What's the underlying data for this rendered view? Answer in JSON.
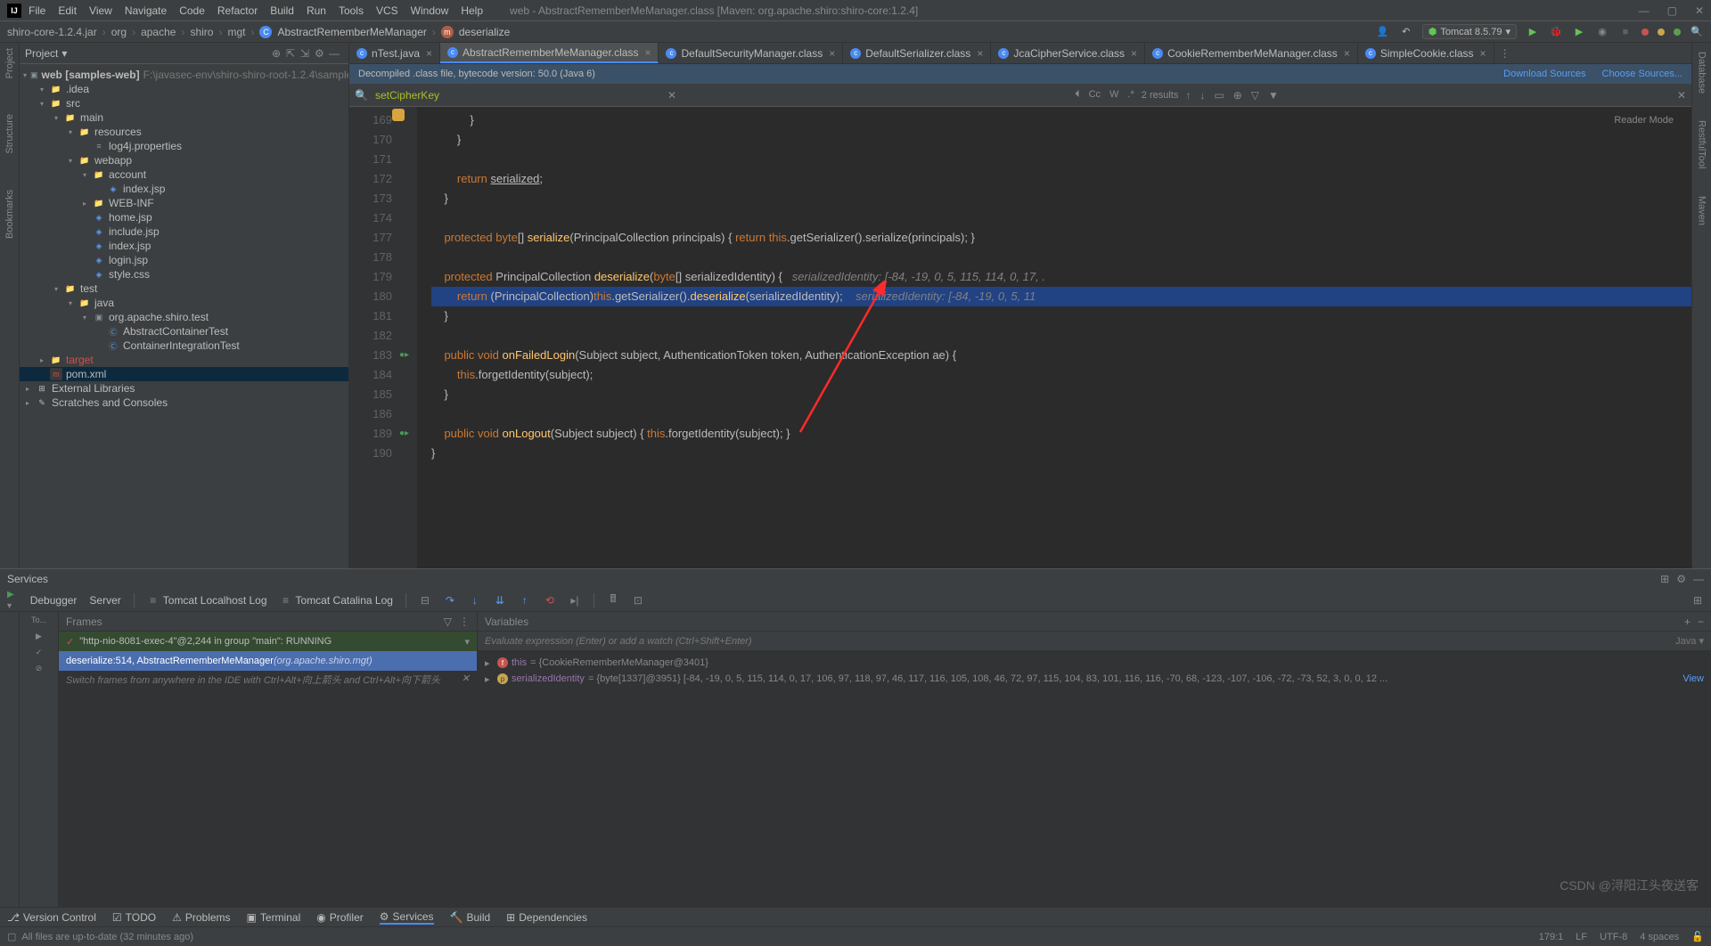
{
  "titlebar": {
    "menus": [
      "File",
      "Edit",
      "View",
      "Navigate",
      "Code",
      "Refactor",
      "Build",
      "Run",
      "Tools",
      "VCS",
      "Window",
      "Help"
    ],
    "title": "web - AbstractRememberMeManager.class [Maven: org.apache.shiro:shiro-core:1.2.4]"
  },
  "breadcrumb": {
    "jar": "shiro-core-1.2.4.jar",
    "parts": [
      "org",
      "apache",
      "shiro",
      "mgt"
    ],
    "class": "AbstractRememberMeManager",
    "method": "deserialize"
  },
  "runconfig": "Tomcat 8.5.79",
  "project": {
    "header": "Project",
    "root": "web [samples-web]",
    "root_path": "F:\\javasec-env\\shiro-shiro-root-1.2.4\\samples\\web",
    "items": [
      {
        "depth": 1,
        "arrow": "▾",
        "icon": "folder",
        "name": ".idea"
      },
      {
        "depth": 1,
        "arrow": "▾",
        "icon": "folder",
        "name": "src"
      },
      {
        "depth": 2,
        "arrow": "▾",
        "icon": "folder",
        "name": "main"
      },
      {
        "depth": 3,
        "arrow": "▾",
        "icon": "folder",
        "name": "resources"
      },
      {
        "depth": 4,
        "arrow": "",
        "icon": "prop",
        "name": "log4j.properties"
      },
      {
        "depth": 3,
        "arrow": "▾",
        "icon": "folder",
        "name": "webapp"
      },
      {
        "depth": 4,
        "arrow": "▾",
        "icon": "folder",
        "name": "account"
      },
      {
        "depth": 5,
        "arrow": "",
        "icon": "jsp",
        "name": "index.jsp"
      },
      {
        "depth": 4,
        "arrow": "▸",
        "icon": "folder",
        "name": "WEB-INF"
      },
      {
        "depth": 4,
        "arrow": "",
        "icon": "jsp",
        "name": "home.jsp"
      },
      {
        "depth": 4,
        "arrow": "",
        "icon": "jsp",
        "name": "include.jsp"
      },
      {
        "depth": 4,
        "arrow": "",
        "icon": "jsp",
        "name": "index.jsp"
      },
      {
        "depth": 4,
        "arrow": "",
        "icon": "jsp",
        "name": "login.jsp"
      },
      {
        "depth": 4,
        "arrow": "",
        "icon": "css",
        "name": "style.css"
      },
      {
        "depth": 2,
        "arrow": "▾",
        "icon": "folder",
        "name": "test"
      },
      {
        "depth": 3,
        "arrow": "▾",
        "icon": "folder",
        "name": "java"
      },
      {
        "depth": 4,
        "arrow": "▾",
        "icon": "pkg",
        "name": "org.apache.shiro.test"
      },
      {
        "depth": 5,
        "arrow": "",
        "icon": "java",
        "name": "AbstractContainerTest"
      },
      {
        "depth": 5,
        "arrow": "",
        "icon": "java",
        "name": "ContainerIntegrationTest"
      },
      {
        "depth": 1,
        "arrow": "▸",
        "icon": "folder",
        "name": "target",
        "cls": "exclude"
      },
      {
        "depth": 1,
        "arrow": "",
        "icon": "xml",
        "name": "pom.xml",
        "sel": true
      },
      {
        "depth": 0,
        "arrow": "▸",
        "icon": "lib",
        "name": "External Libraries"
      },
      {
        "depth": 0,
        "arrow": "▸",
        "icon": "scratch",
        "name": "Scratches and Consoles"
      }
    ]
  },
  "tabs": [
    {
      "label": "nTest.java",
      "active": false
    },
    {
      "label": "AbstractRememberMeManager.class",
      "active": true
    },
    {
      "label": "DefaultSecurityManager.class",
      "active": false
    },
    {
      "label": "DefaultSerializer.class",
      "active": false
    },
    {
      "label": "JcaCipherService.class",
      "active": false
    },
    {
      "label": "CookieRememberMeManager.class",
      "active": false
    },
    {
      "label": "SimpleCookie.class",
      "active": false
    }
  ],
  "infobar": {
    "text": "Decompiled .class file, bytecode version: 50.0 (Java 6)",
    "link1": "Download Sources",
    "link2": "Choose Sources..."
  },
  "search": {
    "query": "setCipherKey",
    "results": "2 results"
  },
  "reader_mode": "Reader Mode",
  "code": {
    "lines": [
      {
        "n": "",
        "html": "            }"
      },
      {
        "n": "169",
        "html": "        }"
      },
      {
        "n": "170",
        "html": ""
      },
      {
        "n": "171",
        "html": "        <span class='kw'>return</span> <span class='ul'>serialized</span>;"
      },
      {
        "n": "172",
        "html": "    }"
      },
      {
        "n": "173",
        "html": ""
      },
      {
        "n": "174",
        "html": "    <span class='kw'>protected</span> <span class='kw'>byte</span>[] <span class='fn'>serialize</span>(PrincipalCollection principals) { <span class='kw'>return</span> <span class='this'>this</span>.getSerializer().serialize(principals); }"
      },
      {
        "n": "177",
        "html": ""
      },
      {
        "n": "178",
        "html": "    <span class='kw'>protected</span> PrincipalCollection <span class='fn'>deserialize</span>(<span class='kw'>byte</span>[] serializedIdentity) {   <span class='cm'>serializedIdentity: [-84, -19, 0, 5, 115, 114, 0, 17, .</span>"
      },
      {
        "n": "179",
        "html": "        <span class='kw'>return</span> (PrincipalCollection)<span class='this'>this</span>.getSerializer().<span class='fn'>deserialize</span>(serializedIdentity);    <span class='cm'>serializedIdentity: [-84, -19, 0, 5, 11</span>",
        "hl": true,
        "bulb": true
      },
      {
        "n": "180",
        "html": "    }"
      },
      {
        "n": "181",
        "html": ""
      },
      {
        "n": "182",
        "html": "    <span class='kw'>public</span> <span class='kw'>void</span> <span class='fn'>onFailedLogin</span>(Subject subject, AuthenticationToken token, AuthenticationException ae) {",
        "mark": "●▸"
      },
      {
        "n": "183",
        "html": "        <span class='this'>this</span>.forgetIdentity(subject);"
      },
      {
        "n": "184",
        "html": "    }"
      },
      {
        "n": "185",
        "html": ""
      },
      {
        "n": "186",
        "html": "    <span class='kw'>public</span> <span class='kw'>void</span> <span class='fn'>onLogout</span>(Subject subject) { <span class='this'>this</span>.forgetIdentity(subject); }",
        "mark": "●▸"
      },
      {
        "n": "189",
        "html": "}"
      },
      {
        "n": "190",
        "html": ""
      }
    ]
  },
  "services": {
    "title": "Services",
    "tabs": [
      "Debugger",
      "Server",
      "Tomcat Localhost Log",
      "Tomcat Catalina Log"
    ],
    "tree_items": [
      "To...",
      "▶",
      "✓",
      "⊘"
    ],
    "frames": {
      "title": "Frames",
      "running": "\"http-nio-8081-exec-4\"@2,244 in group \"main\": RUNNING",
      "sel_main": "deserialize:514, AbstractRememberMeManager ",
      "sel_dim": "(org.apache.shiro.mgt)",
      "hint": "Switch frames from anywhere in the IDE with Ctrl+Alt+向上箭头 and Ctrl+Alt+向下箭头"
    },
    "variables": {
      "title": "Variables",
      "eval_hint": "Evaluate expression (Enter) or add a watch (Ctrl+Shift+Enter)",
      "lang": "Java ▾",
      "rows": [
        {
          "badge": "red",
          "name": "this",
          "val": " = {CookieRememberMeManager@3401}"
        },
        {
          "badge": "yel",
          "name": "serializedIdentity",
          "val": " = {byte[1337]@3951} [-84, -19, 0, 5, 115, 114, 0, 17, 106, 97, 118, 97, 46, 117, 116, 105, 108, 46, 72, 97, 115, 104, 83, 101, 116, 116, -70, 68, -123, -107, -106, -72, -73, 52, 3, 0, 0, 12 ...",
          "link": "View"
        }
      ]
    }
  },
  "bottom_tabs": [
    "Version Control",
    "TODO",
    "Problems",
    "Terminal",
    "Profiler",
    "Services",
    "Build",
    "Dependencies"
  ],
  "statusbar": {
    "left": "All files are up-to-date (32 minutes ago)",
    "right": [
      "179:1",
      "LF",
      "UTF-8",
      "4 spaces"
    ]
  },
  "watermark": "CSDN @浔阳江头夜送客"
}
